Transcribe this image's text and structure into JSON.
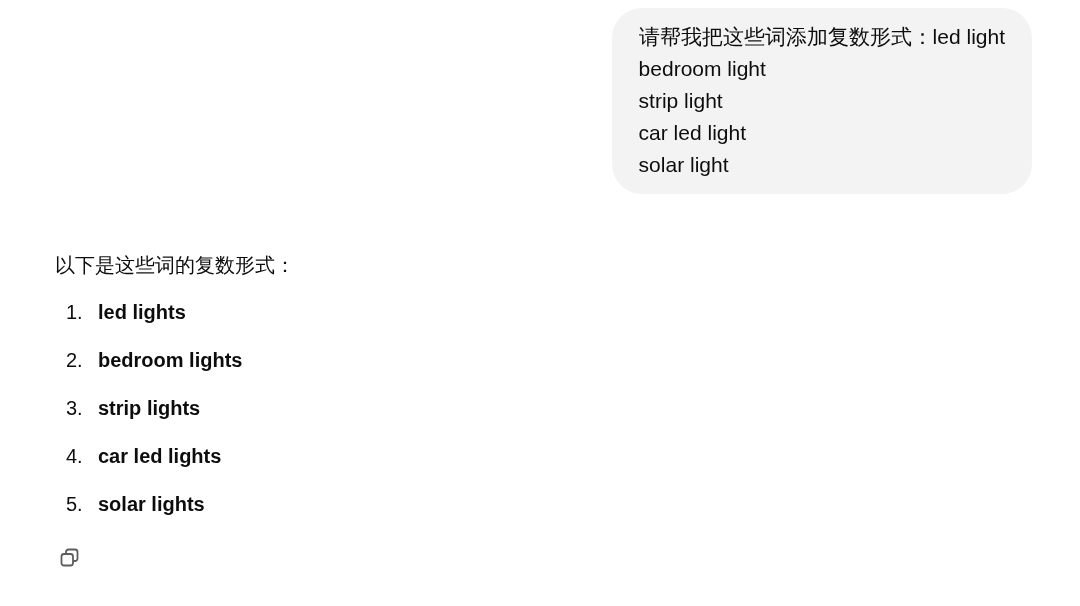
{
  "user_message": {
    "lines": [
      "请帮我把这些词添加复数形式：led light",
      "bedroom light",
      "strip light",
      "car led light",
      "solar light"
    ]
  },
  "assistant_message": {
    "intro": "以下是这些词的复数形式：",
    "items": [
      {
        "number": "1.",
        "text": "led lights"
      },
      {
        "number": "2.",
        "text": "bedroom lights"
      },
      {
        "number": "3.",
        "text": "strip lights"
      },
      {
        "number": "4.",
        "text": "car led lights"
      },
      {
        "number": "5.",
        "text": "solar lights"
      }
    ]
  }
}
